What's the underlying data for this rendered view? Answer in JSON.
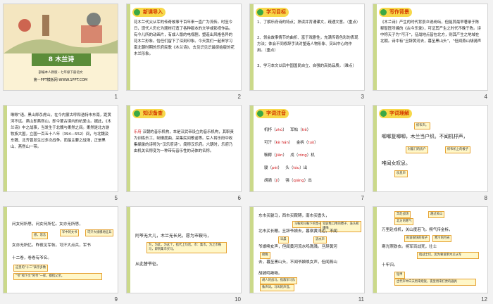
{
  "slides": [
    {
      "n": "1",
      "title": "8 木兰诗",
      "sub1": "部编本人教版・七年级下册语文",
      "sub2": "第一PPT模板网-WWW.1PPT.COM"
    },
    {
      "n": "2",
      "tag": "新课导入",
      "text": "花木兰代父从军的传奇故事千百年来一直广为流传。时至今日，现代人仍它为题材打造了各种版本的文学或影视作品。有今儿所的动画片，有成人版的电视剧，塑造出风格各异的花木兰形象。恰任们留下了深刻印象。今天我们一起来学习南北朝时期的乐府民歌《木兰诗》，去见识见识最原始版的花木兰形象。"
    },
    {
      "n": "3",
      "tag": "学习目标",
      "l1": "1、了解乐府诗的特点；熟读并背诵课文，疏通文意。（重点）",
      "l2": "2、领会故事情节的曲折、富于戏剧性，充满传奇色彩的表现方法；体会不同修辞手法对塑造人物形象、突出中心的作用。（重点）",
      "l3": "3、学习本文以后中国国民自立、自强的高尚品质。（难点）"
    },
    {
      "n": "4",
      "tag": "写作背景",
      "text": "《木兰诗》产生的时代背景众说纷纭，但能其最早著录于陈释智匠所编的《古今乐录》，可证其产生之时代不晚于陈。诗中称天子为“可汗”，征战地点皆在北方，则其产生之地域在北朝。诗中有“旦辞黄河去，暮至黑山头”，“但闻燕山胡骑声"
    },
    {
      "n": "5",
      "text": "啾啾”语。黑山即杀虎山，在今内蒙古呼和浩特市东南，距黄河不远。燕山即燕然山，即今蒙古境内的杭爱山。据此，《木兰诗》中之战事，当发生于北魏与柔然之间。柔然是北方游牧族大国，立国一百五十八年（394—552）间，与北魏及东魏、北齐曾发生过多次战争。而最主要之战场，正是黑山、燕然山一带。"
    },
    {
      "n": "6",
      "tag": "知识备查",
      "head": "乐府",
      "text": "汉朝的音乐机构，本是汉武帝设立的音乐机构，其职责为训练乐工，制谱度曲，采集民间歌谣等。后人将乐府中收集编录的诗称为“汉乐府诗”。简称汉乐府。六朝时，乐府乃由机关名称变为一种带有音乐性的诗体的名称。"
    },
    {
      "n": "7",
      "tag": "字词注音",
      "rows": [
        {
          "a": "机杼",
          "pa": "zhù",
          "b": "军帖",
          "pb": "tiě"
        },
        {
          "a": "可汗",
          "pa": "kè hán",
          "b": "金柝",
          "pb": "tuò"
        },
        {
          "a": "鞍鞯",
          "pa": "jiān",
          "b": "戍",
          "pb": "róng",
          "c": "机"
        },
        {
          "a": "骏",
          "pa": "pèi",
          "b": "头",
          "pb": "tóu",
          "c": "出"
        },
        {
          "a": "胡骑",
          "pa": "jì",
          "b": "强",
          "pb": "qiáng",
          "c": "出"
        }
      ]
    },
    {
      "n": "8",
      "tag": "字词理解",
      "b1": "织布声。",
      "line": "唧唧复唧唧，木兰当户织。不闻机杼声，",
      "b2": "对着门的房户",
      "b3": "织布机上的梭子",
      "line2": "唯闻女叹息。",
      "b4": "叹息声"
    },
    {
      "n": "9",
      "line1": "问女何所思，问女何所忆。女亦无所思，",
      "line2": "女亦无所忆。昨夜见军帖，可汗大点兵，军书",
      "line3": "十二卷，卷卷有爷名。",
      "b1": "想，思念",
      "b2": "军中的文书",
      "b3": "可汗大规模地征兵",
      "b4": "这里的“十二”表示多数",
      "b5": "“爷”和下文“阿爷”一样，都指父亲。"
    },
    {
      "n": "10",
      "line1": "阿爷无大儿，木兰无长兄，愿为市鞍马，",
      "line2": "从此替爷征。",
      "b1": "为，为此，为这个，指代上句话。市：集市。为之市鞍马，即到集市买马。"
    },
    {
      "n": "11",
      "line1": "东市买骏马，西市买鞍鞯，南市买辔头，",
      "line2": "北市买长鞭。旦辞爷娘去，暮宿黄河边，不闻",
      "line3": "爷娘唤女声，但闻黄河流水鸣溅溅。旦辞黄河",
      "line4": "去，暮至黑山头，不闻爷娘唤女声，但闻燕山",
      "line5": "胡骑鸣啾啾。",
      "b1": "马鞍和马鞍下的垫子",
      "b2": "驾驭牲口用的嚼子、笼头和缰绳",
      "b3": "早晨",
      "b4": "流水声",
      "b5": "傍晚",
      "b6": "胡人的战马，指敌军马队",
      "b7": "象声词。马叫的声音。"
    },
    {
      "n": "12",
      "line1": "万里赴戎机，关山度若飞。朔气传金柝，",
      "line2": "寒光照铁衣。将军百战死，壮士",
      "line3": "十年归。",
      "b1": "奔赴战场",
      "b2": "越过关山",
      "b3": "北方的寒气",
      "b4": "铠甲",
      "b5": "指战士们。因为要说明木兰从军",
      "b6": "形容很快的样子",
      "b7": "寒冷的月光",
      "b8": "古代军中白天用来烧饭，夜里用来打更的器具"
    }
  ]
}
